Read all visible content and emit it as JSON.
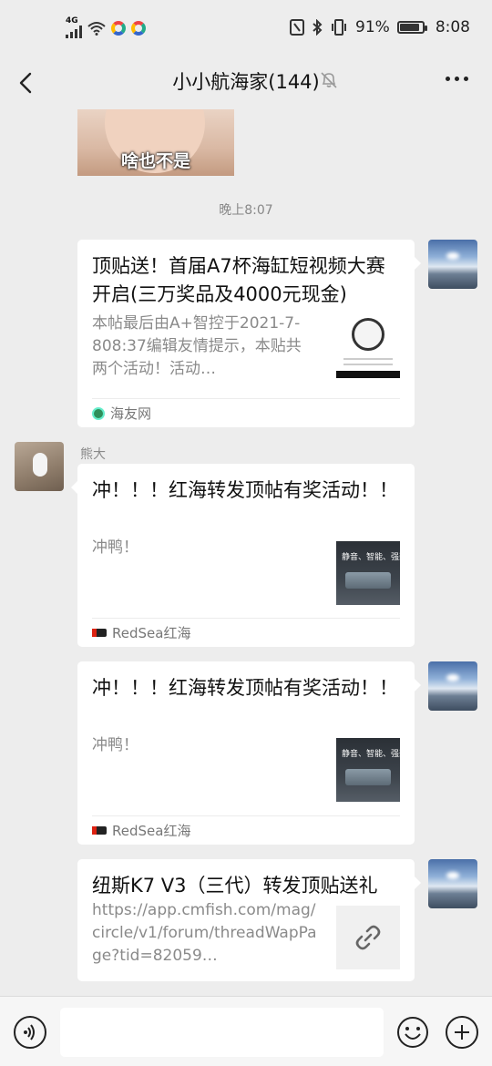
{
  "status_bar": {
    "network": "4G",
    "battery_percent": "91%",
    "time": "8:08",
    "icons": [
      "signal-icon",
      "wifi-icon",
      "app-icon",
      "app-icon",
      "nfc-icon",
      "bluetooth-icon",
      "vibrate-icon",
      "battery-icon"
    ]
  },
  "header": {
    "title": "小小航海家(144)",
    "icons": [
      "back-icon",
      "mute-bell-icon",
      "more-icon"
    ]
  },
  "chat": {
    "image_caption": "啥也不是",
    "timestamp": "晚上8:07",
    "messages": [
      {
        "side": "right",
        "title": "顶贴送！首届A7杯海缸短视频大赛开启(三万奖品及4000元现金)",
        "desc": "本帖最后由A+智控于2021-7-808:37编辑友情提示，本贴共两个活动！活动…",
        "source": "海友网"
      },
      {
        "side": "left",
        "sender": "熊大",
        "title": "冲！！！红海转发顶帖有奖活动！！",
        "desc": "冲鸭！",
        "thumb_text": "静音、智能、强劲",
        "source": "RedSea红海"
      },
      {
        "side": "right",
        "title": "冲！！！红海转发顶帖有奖活动！！",
        "desc": "冲鸭！",
        "thumb_text": "静音、智能、强劲",
        "source": "RedSea红海"
      },
      {
        "side": "right",
        "title": "纽斯K7 V3（三代）转发顶贴送礼",
        "desc": "https://app.cmfish.com/mag/circle/v1/forum/threadWapPage?tid=82059…"
      }
    ]
  },
  "input_bar": {
    "icons": [
      "voice-icon",
      "emoji-icon",
      "plus-icon"
    ]
  }
}
